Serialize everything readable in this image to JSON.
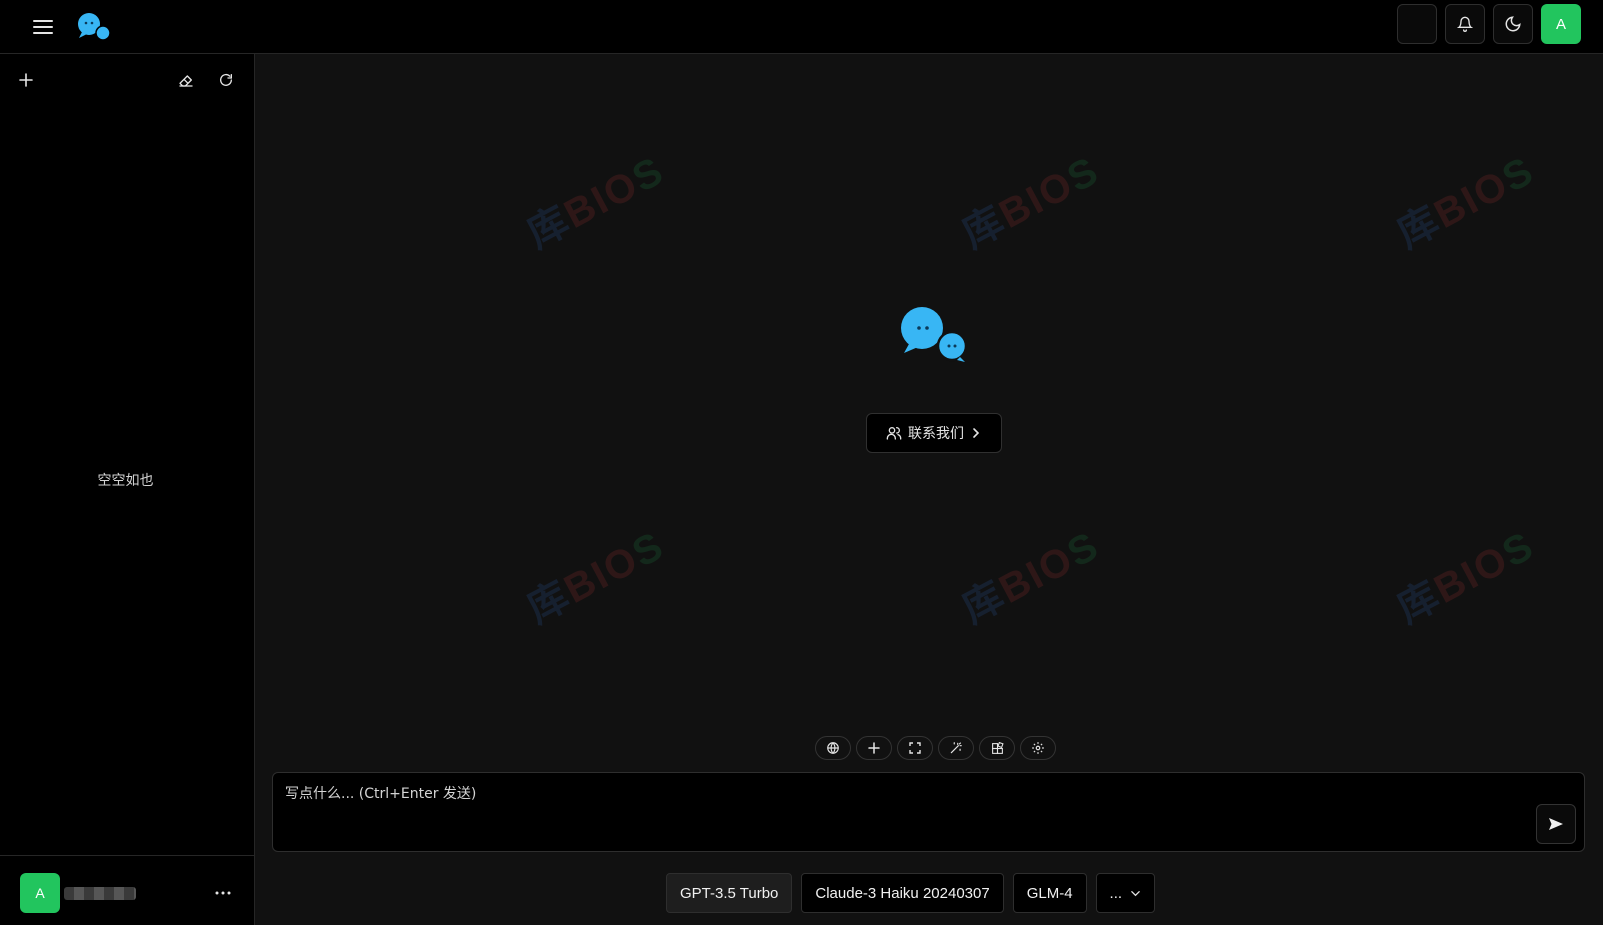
{
  "header": {
    "avatar_letter": "A"
  },
  "sidebar": {
    "empty_text": "空空如也",
    "user": {
      "avatar_letter": "A"
    }
  },
  "main": {
    "contact_label": "联系我们",
    "input_placeholder": "写点什么... (Ctrl+Enter 发送)",
    "models": [
      {
        "label": "GPT-3.5 Turbo",
        "active": true
      },
      {
        "label": "Claude-3 Haiku 20240307",
        "active": false
      },
      {
        "label": "GLM-4",
        "active": false
      }
    ],
    "more_models_label": "..."
  },
  "colors": {
    "accent_green": "#22c55e",
    "logo_blue": "#38b6f4",
    "background": "#111111",
    "sidebar_bg": "#000000"
  }
}
